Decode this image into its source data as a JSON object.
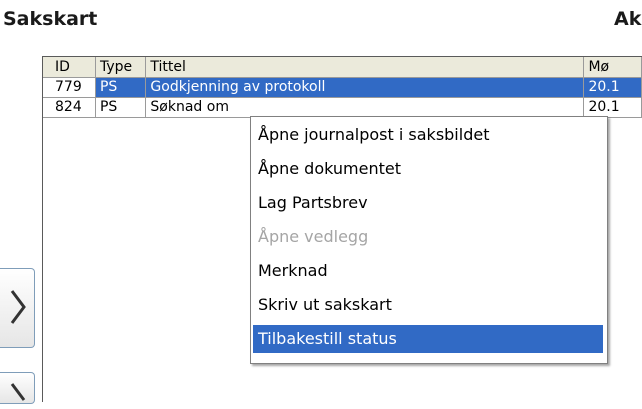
{
  "header": {
    "title": "Sakskart",
    "right_title": "Ak"
  },
  "grid": {
    "columns": [
      "ID",
      "Type",
      "Tittel",
      "Mø"
    ],
    "rows": [
      {
        "id": "779",
        "type": "PS",
        "tittel": "Godkjenning av protokoll",
        "mote": "20.1"
      },
      {
        "id": "824",
        "type": "PS",
        "tittel": "Søknad om",
        "mote": "20.1"
      }
    ]
  },
  "context_menu": {
    "items": [
      {
        "label": "Åpne journalpost i saksbildet",
        "state": "enabled"
      },
      {
        "label": "Åpne dokumentet",
        "state": "enabled"
      },
      {
        "label": "Lag Partsbrev",
        "state": "enabled"
      },
      {
        "label": "Åpne vedlegg",
        "state": "disabled"
      },
      {
        "label": "Merknad",
        "state": "enabled"
      },
      {
        "label": "Skriv ut sakskart",
        "state": "enabled"
      },
      {
        "label": "Tilbakestill status",
        "state": "highlighted"
      }
    ]
  },
  "side_buttons": [
    {
      "icon": "chevron-right-icon"
    },
    {
      "icon": "chevron-right-icon"
    }
  ],
  "colors": {
    "selection": "#316ac5",
    "header_bg": "#ebeadb",
    "disabled_text": "#a5a5a5"
  }
}
